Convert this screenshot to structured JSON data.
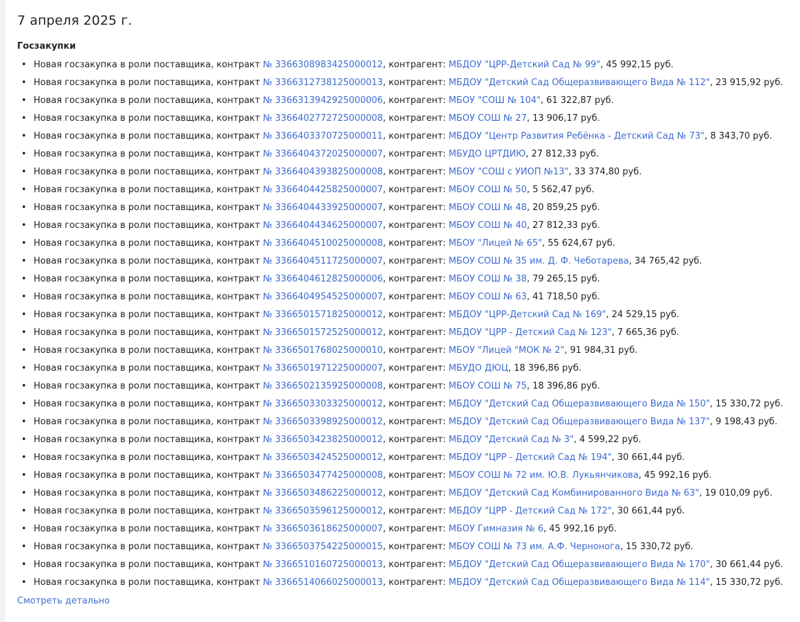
{
  "date_heading": "7 апреля 2025 г.",
  "section_title": "Госзакупки",
  "item_prefix": "Новая госзакупка в роли поставщика, контракт ",
  "counterparty_label": ", контрагент: ",
  "colors": {
    "link": "#3d6bd1",
    "text": "#222222"
  },
  "purchases": [
    {
      "contract": "№ 3366308983425000012",
      "counterparty": "МБДОУ \"ЦРР-Детский Сад № 99\"",
      "amount": ", 45 992,15 руб."
    },
    {
      "contract": "№ 3366312738125000013",
      "counterparty": "МБДОУ \"Детский Сад Общеразвивающего Вида № 112\"",
      "amount": ", 23 915,92 руб."
    },
    {
      "contract": "№ 3366313942925000006",
      "counterparty": "МБОУ \"СОШ № 104\"",
      "amount": ", 61 322,87 руб."
    },
    {
      "contract": "№ 3366402772725000008",
      "counterparty": "МБОУ СОШ № 27",
      "amount": ", 13 906,17 руб."
    },
    {
      "contract": "№ 3366403370725000011",
      "counterparty": "МБДОУ \"Центр Развития Ребёнка - Детский Сад № 73\"",
      "amount": ", 8 343,70 руб."
    },
    {
      "contract": "№ 3366404372025000007",
      "counterparty": "МБУДО ЦРТДИЮ",
      "amount": ", 27 812,33 руб."
    },
    {
      "contract": "№ 3366404393825000008",
      "counterparty": "МБОУ \"СОШ с УИОП №13\"",
      "amount": ", 33 374,80 руб."
    },
    {
      "contract": "№ 3366404425825000007",
      "counterparty": "МБОУ СОШ № 50",
      "amount": ", 5 562,47 руб."
    },
    {
      "contract": "№ 3366404433925000007",
      "counterparty": "МБОУ СОШ № 48",
      "amount": ", 20 859,25 руб."
    },
    {
      "contract": "№ 3366404434625000007",
      "counterparty": "МБОУ СОШ № 40",
      "amount": ", 27 812,33 руб."
    },
    {
      "contract": "№ 3366404510025000008",
      "counterparty": "МБОУ \"Лицей № 65\"",
      "amount": ", 55 624,67 руб."
    },
    {
      "contract": "№ 3366404511725000007",
      "counterparty": "МБОУ СОШ № 35 им. Д. Ф. Чеботарева",
      "amount": ", 34 765,42 руб."
    },
    {
      "contract": "№ 3366404612825000006",
      "counterparty": "МБОУ СОШ № 38",
      "amount": ", 79 265,15 руб."
    },
    {
      "contract": "№ 3366404954525000007",
      "counterparty": "МБОУ СОШ № 63",
      "amount": ", 41 718,50 руб."
    },
    {
      "contract": "№ 3366501571825000012",
      "counterparty": "МБДОУ \"ЦРР-Детский Сад № 169\"",
      "amount": ", 24 529,15 руб."
    },
    {
      "contract": "№ 3366501572525000012",
      "counterparty": "МБДОУ \"ЦРР - Детский Сад № 123\"",
      "amount": ", 7 665,36 руб."
    },
    {
      "contract": "№ 3366501768025000010",
      "counterparty": "МБОУ \"Лицей \"МОК № 2\"",
      "amount": ", 91 984,31 руб."
    },
    {
      "contract": "№ 3366501971225000007",
      "counterparty": "МБУДО ДЮЦ",
      "amount": ", 18 396,86 руб."
    },
    {
      "contract": "№ 3366502135925000008",
      "counterparty": "МБОУ СОШ № 75",
      "amount": ", 18 396,86 руб."
    },
    {
      "contract": "№ 3366503303325000012",
      "counterparty": "МБДОУ \"Детский Сад Общеразвивающего Вида № 150\"",
      "amount": ", 15 330,72 руб."
    },
    {
      "contract": "№ 3366503398925000012",
      "counterparty": "МБДОУ \"Детский Сад Общеразвивающего Вида № 137\"",
      "amount": ", 9 198,43 руб."
    },
    {
      "contract": "№ 3366503423825000012",
      "counterparty": "МБДОУ \"Детский Сад № 3\"",
      "amount": ", 4 599,22 руб."
    },
    {
      "contract": "№ 3366503424525000012",
      "counterparty": "МБДОУ \"ЦРР - Детский Сад № 194\"",
      "amount": ", 30 661,44 руб."
    },
    {
      "contract": "№ 3366503477425000008",
      "counterparty": "МБОУ СОШ № 72 им. Ю.В. Лукьянчикова",
      "amount": ", 45 992,16 руб."
    },
    {
      "contract": "№ 3366503486225000012",
      "counterparty": "МБДОУ \"Детский Сад Комбинированного Вида № 63\"",
      "amount": ", 19 010,09 руб."
    },
    {
      "contract": "№ 3366503596125000012",
      "counterparty": "МБДОУ \"ЦРР - Детский Сад № 172\"",
      "amount": ", 30 661,44 руб."
    },
    {
      "contract": "№ 3366503618625000007",
      "counterparty": "МБОУ Гимназия № 6",
      "amount": ", 45 992,16 руб."
    },
    {
      "contract": "№ 3366503754225000015",
      "counterparty": "МБОУ СОШ № 73 им. А.Ф. Чернонога",
      "amount": ", 15 330,72 руб."
    },
    {
      "contract": "№ 3366510160725000013",
      "counterparty": "МБДОУ \"Детский Сад Общеразвивающего Вида № 170\"",
      "amount": ", 30 661,44 руб."
    },
    {
      "contract": "№ 3366514066025000013",
      "counterparty": "МБДОУ \"Детский Сад Общеразвивающего Вида № 114\"",
      "amount": ", 15 330,72 руб."
    }
  ],
  "more_link": "Смотреть детально"
}
